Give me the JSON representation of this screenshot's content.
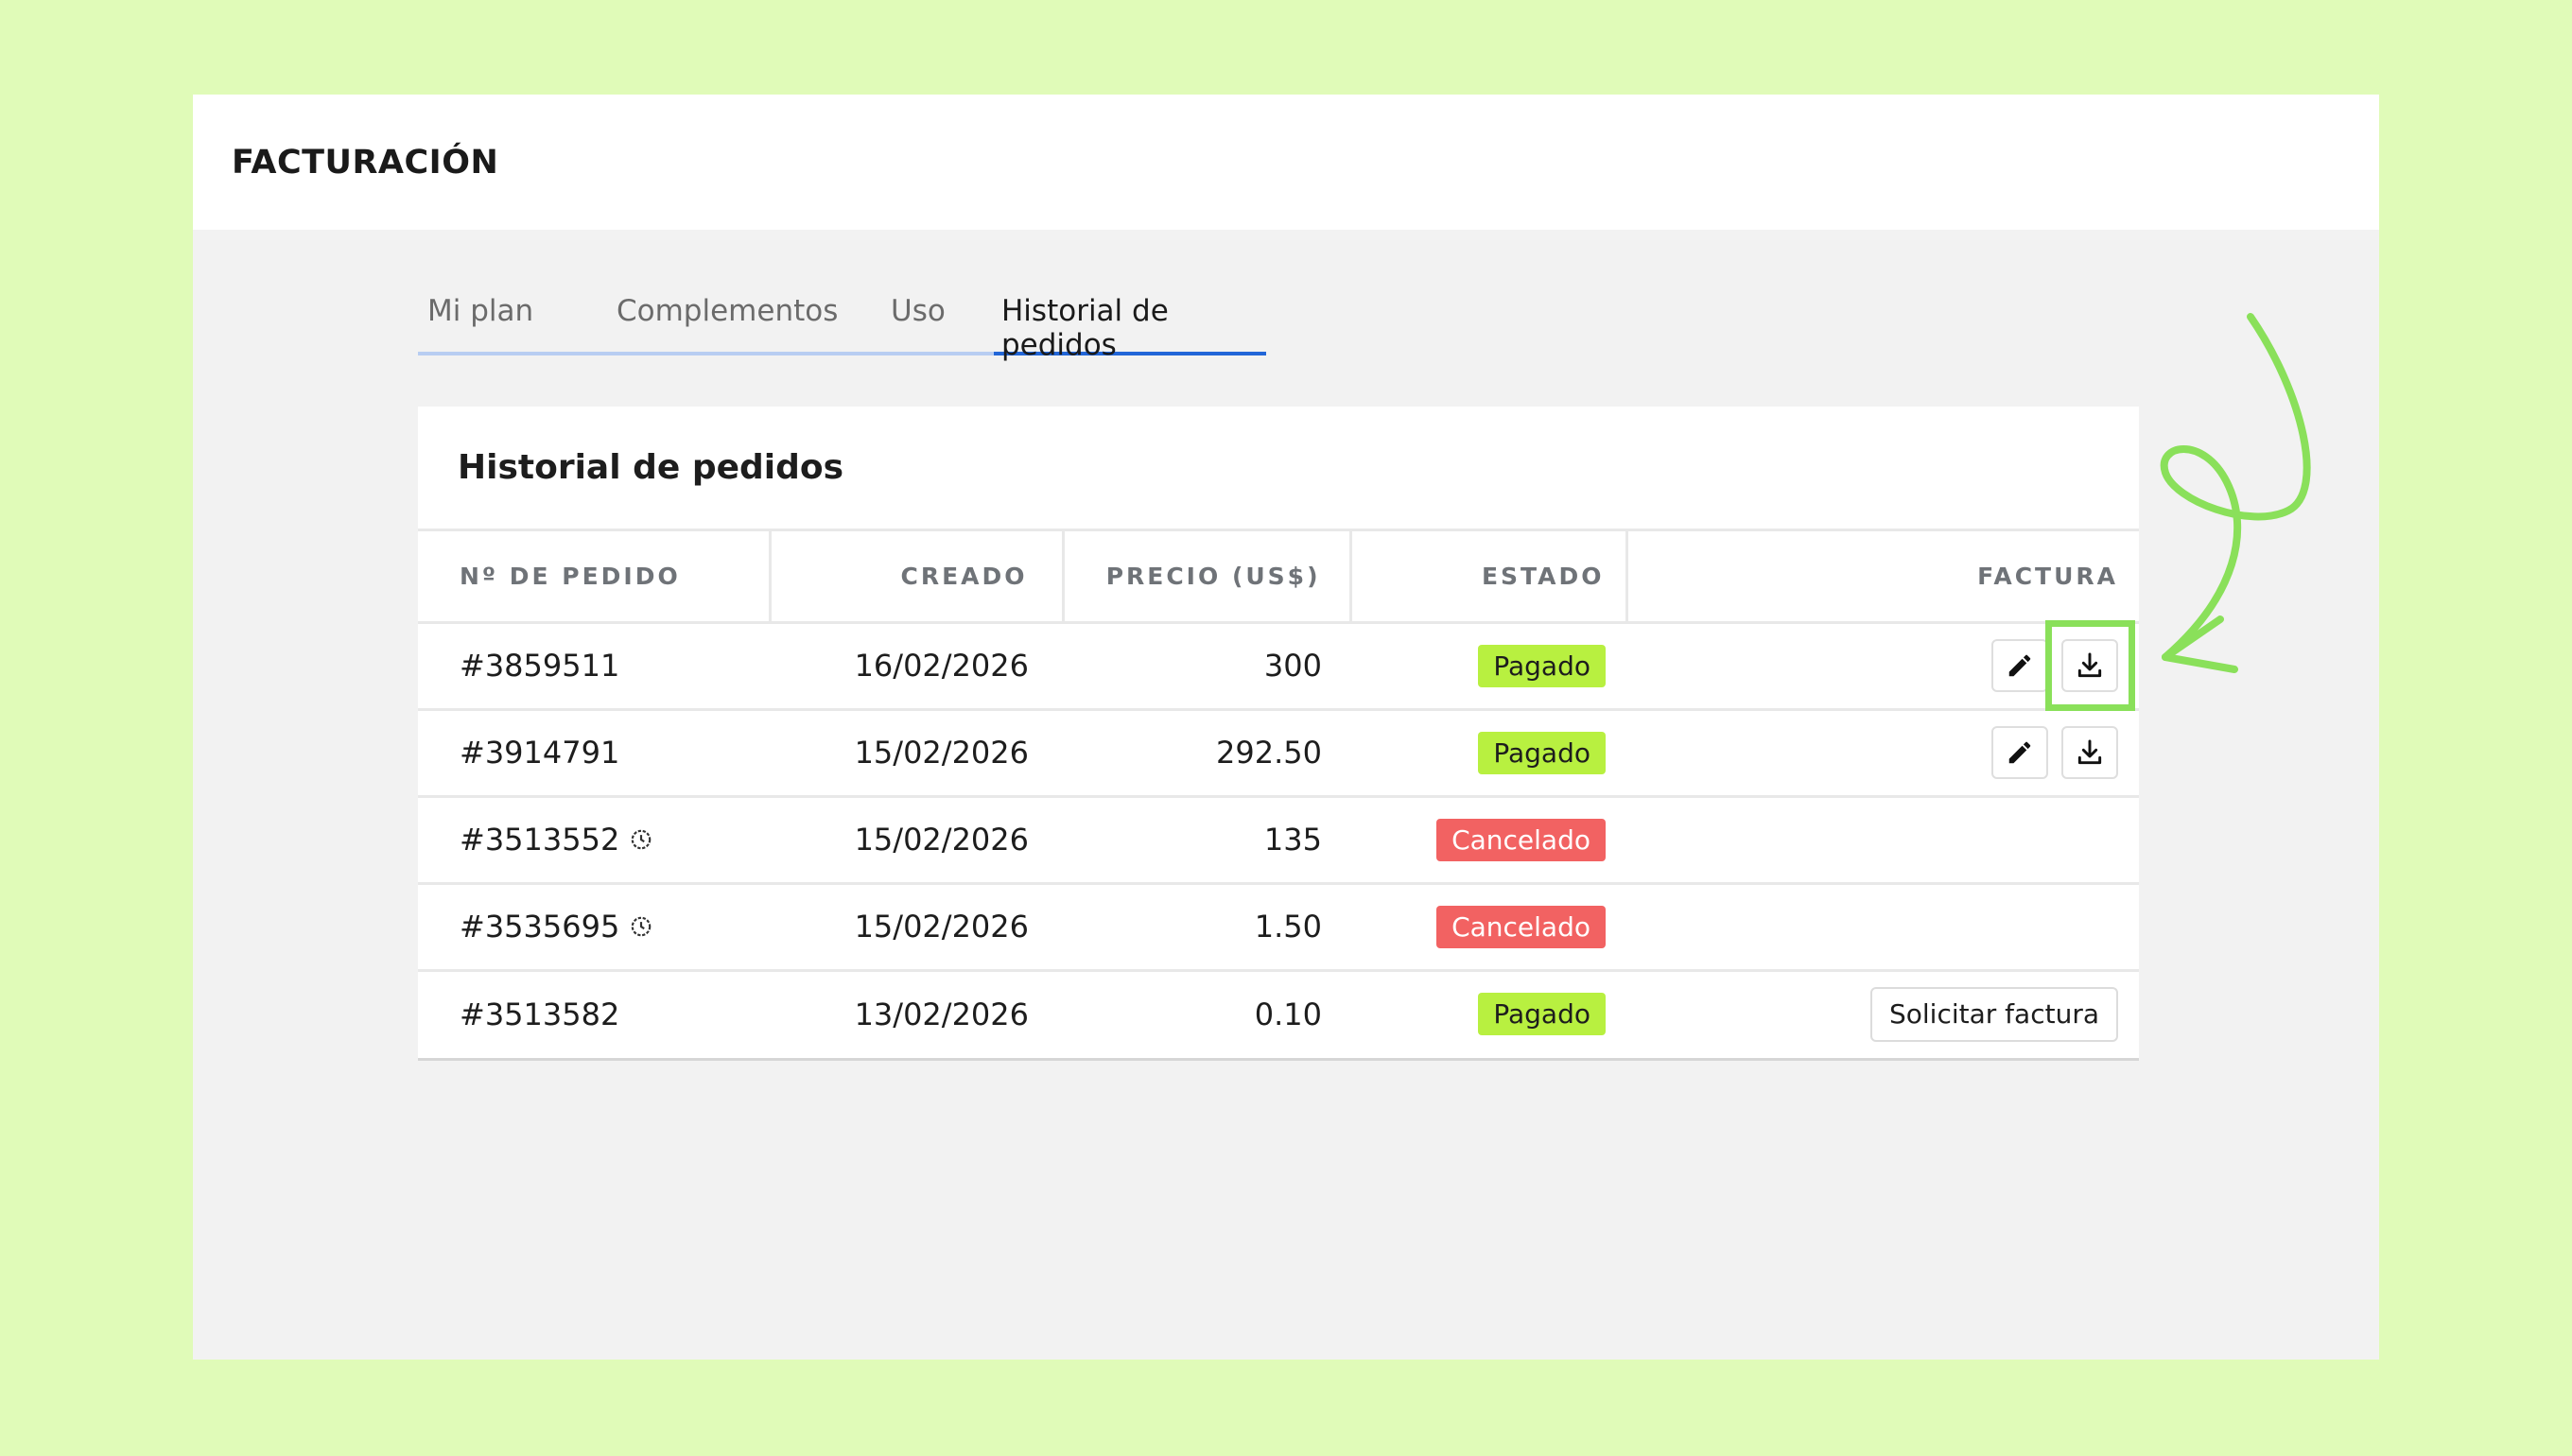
{
  "header": {
    "title": "FACTURACIÓN"
  },
  "tabs": [
    {
      "label": "Mi plan",
      "active": false
    },
    {
      "label": "Complementos",
      "active": false
    },
    {
      "label": "Uso",
      "active": false
    },
    {
      "label": "Historial de pedidos",
      "active": true
    }
  ],
  "card": {
    "title": "Historial de pedidos",
    "columns": [
      "Nº DE PEDIDO",
      "CREADO",
      "PRECIO (US$)",
      "ESTADO",
      "FACTURA"
    ],
    "rows": [
      {
        "id": "#3859511",
        "created": "16/02/2026",
        "price": "300",
        "status": "Pagado",
        "status_type": "paid",
        "invoice": "actions",
        "clock": false
      },
      {
        "id": "#3914791",
        "created": "15/02/2026",
        "price": "292.50",
        "status": "Pagado",
        "status_type": "paid",
        "invoice": "actions",
        "clock": false
      },
      {
        "id": "#3513552",
        "created": "15/02/2026",
        "price": "135",
        "status": "Cancelado",
        "status_type": "cancel",
        "invoice": "none",
        "clock": true
      },
      {
        "id": "#3535695",
        "created": "15/02/2026",
        "price": "1.50",
        "status": "Cancelado",
        "status_type": "cancel",
        "invoice": "none",
        "clock": true
      },
      {
        "id": "#3513582",
        "created": "13/02/2026",
        "price": "0.10",
        "status": "Pagado",
        "status_type": "paid",
        "invoice": "request",
        "clock": false
      }
    ],
    "request_invoice_label": "Solicitar factura"
  },
  "icons": {
    "edit": "pencil-icon",
    "download": "download-icon",
    "clock": "clock-icon"
  },
  "colors": {
    "background": "#e0fbb8",
    "paid_badge": "#b8f040",
    "cancel_badge": "#f26262",
    "active_tab": "#2266d8",
    "annotation": "#8ae05a"
  }
}
